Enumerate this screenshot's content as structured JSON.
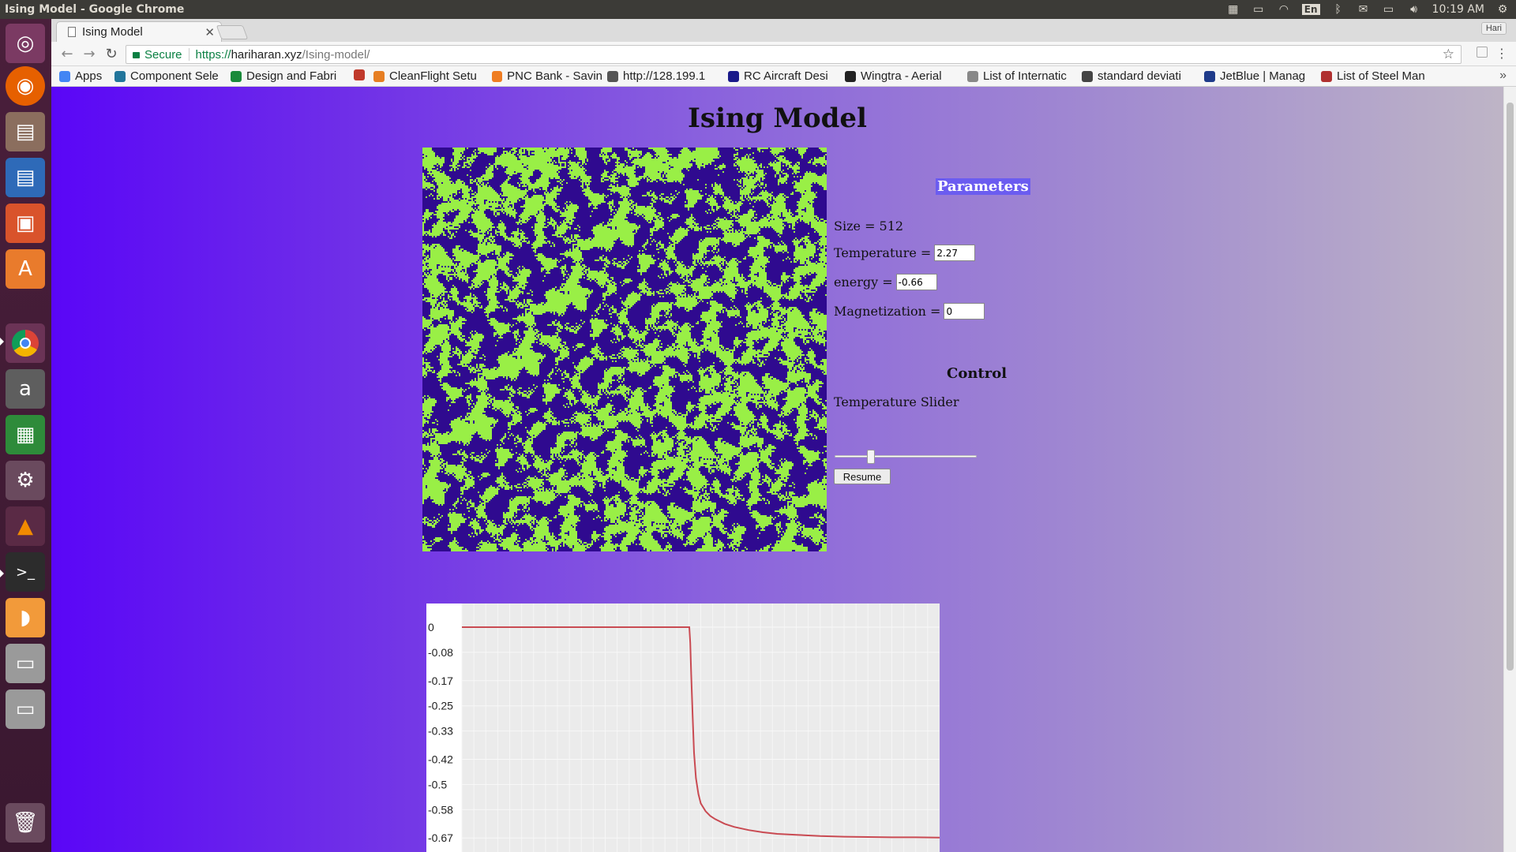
{
  "window": {
    "title": "Ising Model - Google Chrome",
    "clock": "10:19 AM",
    "keyboard_layout": "En",
    "profile_name": "Hari"
  },
  "launcher": {
    "items": [
      "ubuntu-dash",
      "firefox",
      "files",
      "writer",
      "impress",
      "software-center",
      "chrome",
      "amazon",
      "calc",
      "settings",
      "vlc",
      "terminal",
      "app",
      "drive",
      "drive",
      "trash"
    ]
  },
  "browser": {
    "tab_title": "Ising Model",
    "secure_label": "Secure",
    "url_scheme": "https://",
    "url_host": "hariharan.xyz",
    "url_path": "/Ising-model/",
    "bookmarks": [
      {
        "label": "Apps",
        "icon": "apps-icon",
        "color": "#4285f4"
      },
      {
        "label": "Component Sele",
        "icon": "wordpress-icon",
        "color": "#21759b"
      },
      {
        "label": "Design and Fabri",
        "icon": "m-icon",
        "color": "#1a8a3a"
      },
      {
        "label": "",
        "icon": "cherry-icon",
        "color": "#c0392b"
      },
      {
        "label": "CleanFlight Setu",
        "icon": "cleanflight-icon",
        "color": "#e67e22"
      },
      {
        "label": "PNC Bank - Savin",
        "icon": "pnc-icon",
        "color": "#ef7d22"
      },
      {
        "label": "http://128.199.1",
        "icon": "chart-icon",
        "color": "#555555"
      },
      {
        "label": "RC Aircraft Desi",
        "icon": "sl-icon",
        "color": "#1a1a8a"
      },
      {
        "label": "Wingtra - Aerial",
        "icon": "wingtra-icon",
        "color": "#222222"
      },
      {
        "label": "List of Internatic",
        "icon": "page-icon",
        "color": "#888888"
      },
      {
        "label": "standard deviati",
        "icon": "math-icon",
        "color": "#444444"
      },
      {
        "label": "JetBlue | Manag",
        "icon": "jetblue-icon",
        "color": "#1f3b8a"
      },
      {
        "label": "List of Steel Man",
        "icon": "wiki-icon",
        "color": "#b03030"
      }
    ]
  },
  "page": {
    "title": "Ising Model",
    "parameters": {
      "heading": "Parameters",
      "size_text": "Size = 512",
      "temperature_label": "Temperature =",
      "temperature_value": "2.27",
      "energy_label": "energy =",
      "energy_value": "-0.66",
      "magnetization_label": "Magnetization =",
      "magnetization_value": "0"
    },
    "control": {
      "heading": "Control",
      "slider_label": "Temperature Slider",
      "slider_level": 0.24,
      "resume_label": "Resume"
    },
    "lattice_colors": {
      "up": "#99ef46",
      "down": "#2f0a8f"
    }
  },
  "chart_data": {
    "type": "line",
    "title": "",
    "xlabel": "",
    "ylabel": "",
    "y_ticks": [
      "0",
      "-0.08",
      "-0.17",
      "-0.25",
      "-0.33",
      "-0.42",
      "-0.5",
      "-0.58",
      "-0.67"
    ],
    "ylim": [
      -0.7,
      0.03
    ],
    "xlim": [
      0,
      100
    ],
    "series": [
      {
        "color": "#c94a52",
        "x": [
          0,
          10,
          20,
          30,
          40,
          47.6,
          47.8,
          48.0,
          48.3,
          48.6,
          49.0,
          49.5,
          50,
          51,
          52,
          53,
          55,
          57,
          60,
          63,
          66,
          70,
          75,
          80,
          85,
          90,
          95,
          100
        ],
        "y": [
          0,
          0,
          0,
          0,
          0,
          0,
          -0.05,
          -0.15,
          -0.28,
          -0.4,
          -0.48,
          -0.53,
          -0.56,
          -0.585,
          -0.6,
          -0.61,
          -0.625,
          -0.635,
          -0.645,
          -0.652,
          -0.657,
          -0.66,
          -0.664,
          -0.666,
          -0.667,
          -0.668,
          -0.668,
          -0.669
        ]
      }
    ]
  }
}
